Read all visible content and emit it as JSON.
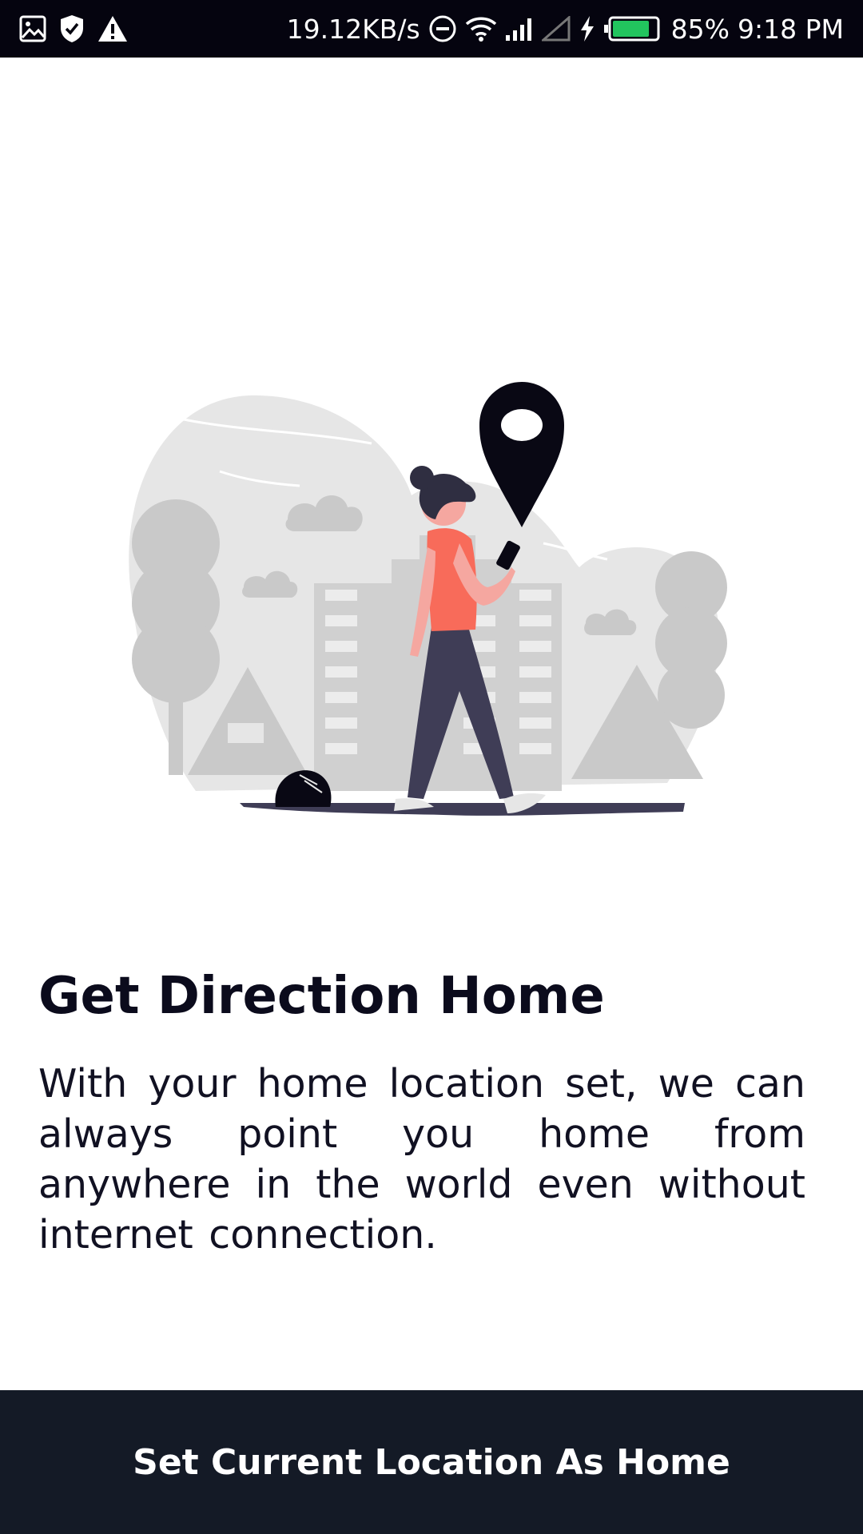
{
  "status_bar": {
    "icons_left": [
      "gallery-icon",
      "shield-check-icon",
      "warning-icon"
    ],
    "network_speed": "19.12KB/s",
    "icons_right": [
      "do-not-disturb-icon",
      "wifi-icon",
      "signal-icon",
      "signal-empty-icon",
      "charging-icon",
      "battery-icon"
    ],
    "battery_percent": "85%",
    "battery_level": 0.85,
    "time": "9:18 PM",
    "battery_color": "#22c55e"
  },
  "onboarding": {
    "illustration": "woman-walking-with-phone-location-pin-illustration",
    "title": "Get Direction Home",
    "description": "With your home location set, we can always point you home from anywhere in the world even without internet connection."
  },
  "cta": {
    "label": "Set Current Location As Home"
  },
  "colors": {
    "status_bar_bg": "#05040f",
    "cta_bg": "#141a26",
    "accent": "#f86b5a",
    "text_primary": "#0b0b1c"
  }
}
